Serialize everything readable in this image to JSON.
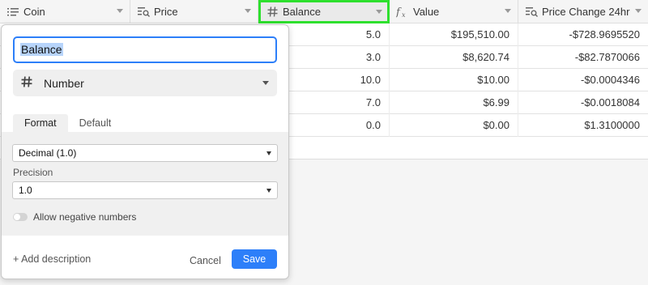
{
  "columns": [
    {
      "label": "Coin",
      "icon": "text-lines-icon"
    },
    {
      "label": "Price",
      "icon": "lookup-icon"
    },
    {
      "label": "Balance",
      "icon": "number-hash-icon"
    },
    {
      "label": "Value",
      "icon": "formula-fx-icon"
    },
    {
      "label": "Price Change 24hr",
      "icon": "lookup-icon"
    }
  ],
  "rows": [
    {
      "balance": "5.0",
      "value": "$195,510.00",
      "change": "-$728.9695520"
    },
    {
      "balance": "3.0",
      "value": "$8,620.74",
      "change": "-$82.7870066"
    },
    {
      "balance": "10.0",
      "value": "$10.00",
      "change": "-$0.0004346"
    },
    {
      "balance": "7.0",
      "value": "$6.99",
      "change": "-$0.0018084"
    },
    {
      "balance": "0.0",
      "value": "$0.00",
      "change": "$1.3100000"
    }
  ],
  "popup": {
    "field_name": "Balance",
    "field_type": "Number",
    "tabs": [
      "Format",
      "Default"
    ],
    "format_value": "Decimal (1.0)",
    "precision_label": "Precision",
    "precision_value": "1.0",
    "allow_negative_label": "Allow negative numbers",
    "allow_negative": false,
    "add_description": "+ Add description",
    "cancel": "Cancel",
    "save": "Save"
  },
  "colors": {
    "accent": "#2d7ff9",
    "active_header_outline": "#2ee02e"
  }
}
